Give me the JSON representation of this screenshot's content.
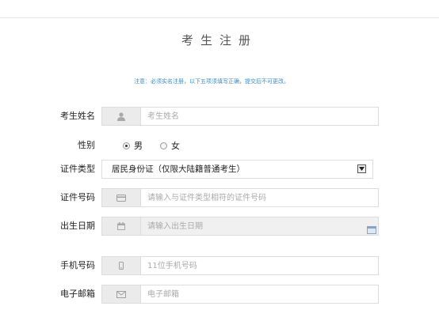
{
  "form": {
    "title": "考生注册",
    "notice": "注意：必须实名注册，以下五项须填写正确，提交后不可更改。",
    "name": {
      "label": "考生姓名",
      "placeholder": "考生姓名",
      "icon": "user-icon"
    },
    "gender": {
      "label": "性别",
      "options": [
        "男",
        "女"
      ],
      "selected": "男"
    },
    "id_type": {
      "label": "证件类型",
      "value": "居民身份证（仅限大陆籍普通考生）"
    },
    "id_number": {
      "label": "证件号码",
      "placeholder": "请输入与证件类型相符的证件号码",
      "icon": "id-card-icon"
    },
    "birth_date": {
      "label": "出生日期",
      "placeholder": "请输入出生日期",
      "icon": "calendar-icon"
    },
    "phone": {
      "label": "手机号码",
      "placeholder": "11位手机号码",
      "icon": "mobile-phone-icon"
    },
    "email": {
      "label": "电子邮箱",
      "placeholder": "电子邮箱",
      "icon": "envelope-icon"
    }
  },
  "colors": {
    "notice": "#3a8ec9",
    "icon_bg": "#ebebeb",
    "border": "#dddddd"
  }
}
